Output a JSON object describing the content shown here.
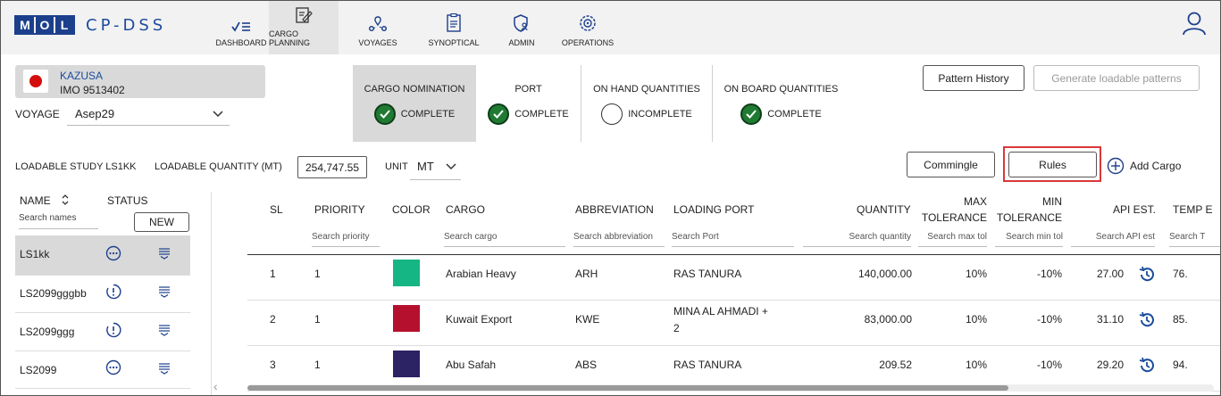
{
  "app": {
    "brand_letters": [
      "M",
      "O",
      "L"
    ],
    "brand_text": "CP-DSS"
  },
  "nav": [
    {
      "label": "DASHBOARD",
      "icon": "dashboard-icon"
    },
    {
      "label": "CARGO PLANNING",
      "icon": "cargo-planning-icon",
      "active": true
    },
    {
      "label": "VOYAGES",
      "icon": "voyages-icon"
    },
    {
      "label": "SYNOPTICAL",
      "icon": "synoptical-icon"
    },
    {
      "label": "ADMIN",
      "icon": "admin-icon"
    },
    {
      "label": "OPERATIONS",
      "icon": "operations-icon"
    }
  ],
  "vessel": {
    "name": "KAZUSA",
    "imo": "IMO 9513402",
    "flag_icon": "japan-flag-icon"
  },
  "voyage": {
    "label": "VOYAGE",
    "value": "Asep29"
  },
  "statuses": [
    {
      "title": "CARGO NOMINATION",
      "state": "COMPLETE",
      "done": true
    },
    {
      "title": "PORT",
      "state": "COMPLETE",
      "done": true
    },
    {
      "title": "ON HAND QUANTITIES",
      "state": "INCOMPLETE",
      "done": false
    },
    {
      "title": "ON BOARD QUANTITIES",
      "state": "COMPLETE",
      "done": true
    }
  ],
  "buttons": {
    "pattern_history": "Pattern History",
    "generate": "Generate loadable patterns",
    "commingle": "Commingle",
    "rules": "Rules",
    "add_cargo": "Add Cargo",
    "new": "NEW"
  },
  "study": {
    "label": "LOADABLE STUDY LS1KK",
    "lq_label": "LOADABLE QUANTITY (MT)",
    "lq_value": "254,747.55",
    "unit_label": "UNIT",
    "unit_value": "MT"
  },
  "left_panel": {
    "name_header": "NAME",
    "status_header": "STATUS",
    "search_placeholder": "Search names",
    "rows": [
      {
        "name": "LS1kk",
        "status": "pending-icon",
        "selected": true
      },
      {
        "name": "LS2099gggbb",
        "status": "alert-icon"
      },
      {
        "name": "LS2099ggg",
        "status": "alert-icon"
      },
      {
        "name": "LS2099",
        "status": "pending-icon"
      }
    ]
  },
  "table": {
    "headers": {
      "sl": "SL",
      "priority": "PRIORITY",
      "color": "COLOR",
      "cargo": "CARGO",
      "abbreviation": "ABBREVIATION",
      "loading_port": "LOADING PORT",
      "quantity": "QUANTITY",
      "max_tol_1": "MAX",
      "max_tol_2": "TOLERANCE",
      "min_tol_1": "MIN",
      "min_tol_2": "TOLERANCE",
      "api": "API EST.",
      "temp": "TEMP E"
    },
    "search": {
      "priority": "Search priority",
      "cargo": "Search cargo",
      "abbreviation": "Search abbreviation",
      "port": "Search Port",
      "quantity": "Search quantity",
      "max_tol": "Search max tol",
      "min_tol": "Search min tol",
      "api": "Search API est",
      "temp": "Search T"
    },
    "rows": [
      {
        "sl": "1",
        "priority": "1",
        "color": "#16b584",
        "cargo": "Arabian Heavy",
        "abbr": "ARH",
        "port_1": "RAS TANURA",
        "port_2": "",
        "quantity": "140,000.00",
        "max_tol": "10%",
        "min_tol": "-10%",
        "api": "27.00",
        "temp": "76."
      },
      {
        "sl": "2",
        "priority": "1",
        "color": "#b5112e",
        "cargo": "Kuwait Export",
        "abbr": "KWE",
        "port_1": "MINA AL AHMADI +",
        "port_2": "2",
        "quantity": "83,000.00",
        "max_tol": "10%",
        "min_tol": "-10%",
        "api": "31.10",
        "temp": "85."
      },
      {
        "sl": "3",
        "priority": "1",
        "color": "#2b2364",
        "cargo": "Abu Safah",
        "abbr": "ABS",
        "port_1": "RAS TANURA",
        "port_2": "",
        "quantity": "209.52",
        "max_tol": "10%",
        "min_tol": "-10%",
        "api": "29.20",
        "temp": "94."
      }
    ]
  },
  "colors": {
    "brand": "#1c3f8c",
    "complete": "#1f7a32",
    "highlight": "#d9383a",
    "history_icon": "#1a4c9c"
  }
}
